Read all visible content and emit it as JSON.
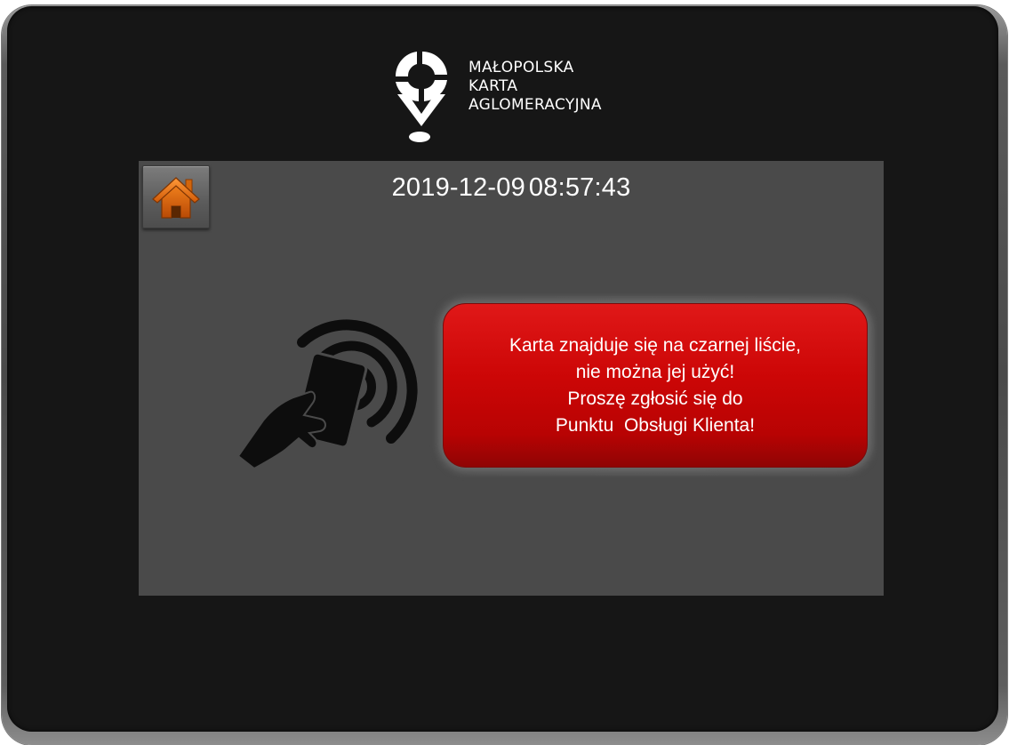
{
  "logo": {
    "line1": "MAŁOPOLSKA",
    "line2": "KARTA",
    "line3": "AGLOMERACYJNA"
  },
  "header": {
    "date": "2019-12-09",
    "time": "08:57:43"
  },
  "alert": {
    "line1": "Karta znajduje się na czarnej liście,",
    "line2": "nie można jej użyć!",
    "line3": "Proszę zgłosić się do",
    "line4": "Punktu  Obsługi Klienta!"
  },
  "icons": {
    "home": "home-icon",
    "nfc": "contactless-card-icon"
  },
  "colors": {
    "alert_red": "#cc0606",
    "screen_bg": "#4a4a4a",
    "bezel": "#161616",
    "home_orange": "#e8720c"
  }
}
